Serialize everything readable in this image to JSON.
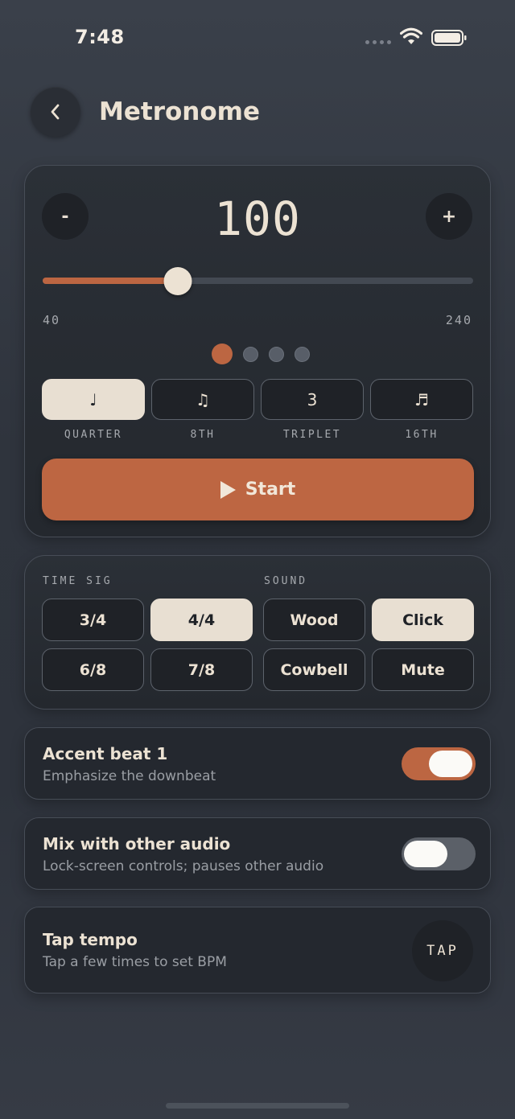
{
  "status": {
    "time": "7:48"
  },
  "header": {
    "title": "Metronome"
  },
  "tempo": {
    "bpm": "100",
    "minus": "-",
    "plus": "+",
    "range_min": "40",
    "range_max": "240",
    "slider_value": 100,
    "beats": [
      true,
      false,
      false,
      false
    ]
  },
  "subdivisions": [
    {
      "glyph": "♩",
      "label": "QUARTER",
      "selected": true
    },
    {
      "glyph": "♫",
      "label": "8TH",
      "selected": false
    },
    {
      "glyph": "3",
      "label": "TRIPLET",
      "selected": false
    },
    {
      "glyph": "♬",
      "label": "16TH",
      "selected": false
    }
  ],
  "start_label": "Start",
  "time_sig": {
    "label": "TIME SIG",
    "options": [
      {
        "label": "3/4",
        "selected": false
      },
      {
        "label": "4/4",
        "selected": true
      },
      {
        "label": "6/8",
        "selected": false
      },
      {
        "label": "7/8",
        "selected": false
      }
    ]
  },
  "sound": {
    "label": "SOUND",
    "options": [
      {
        "label": "Wood",
        "selected": false
      },
      {
        "label": "Click",
        "selected": true
      },
      {
        "label": "Cowbell",
        "selected": false
      },
      {
        "label": "Mute",
        "selected": false
      }
    ]
  },
  "settings": [
    {
      "title": "Accent beat 1",
      "subtitle": "Emphasize the downbeat",
      "on": true
    },
    {
      "title": "Mix with other audio",
      "subtitle": "Lock-screen controls; pauses other audio",
      "on": false
    }
  ],
  "tap": {
    "title": "Tap tempo",
    "subtitle": "Tap a few times to set BPM",
    "button": "TAP"
  },
  "colors": {
    "accent": "#bc6642",
    "cream": "#e8dfd2",
    "card": "#24282e"
  }
}
